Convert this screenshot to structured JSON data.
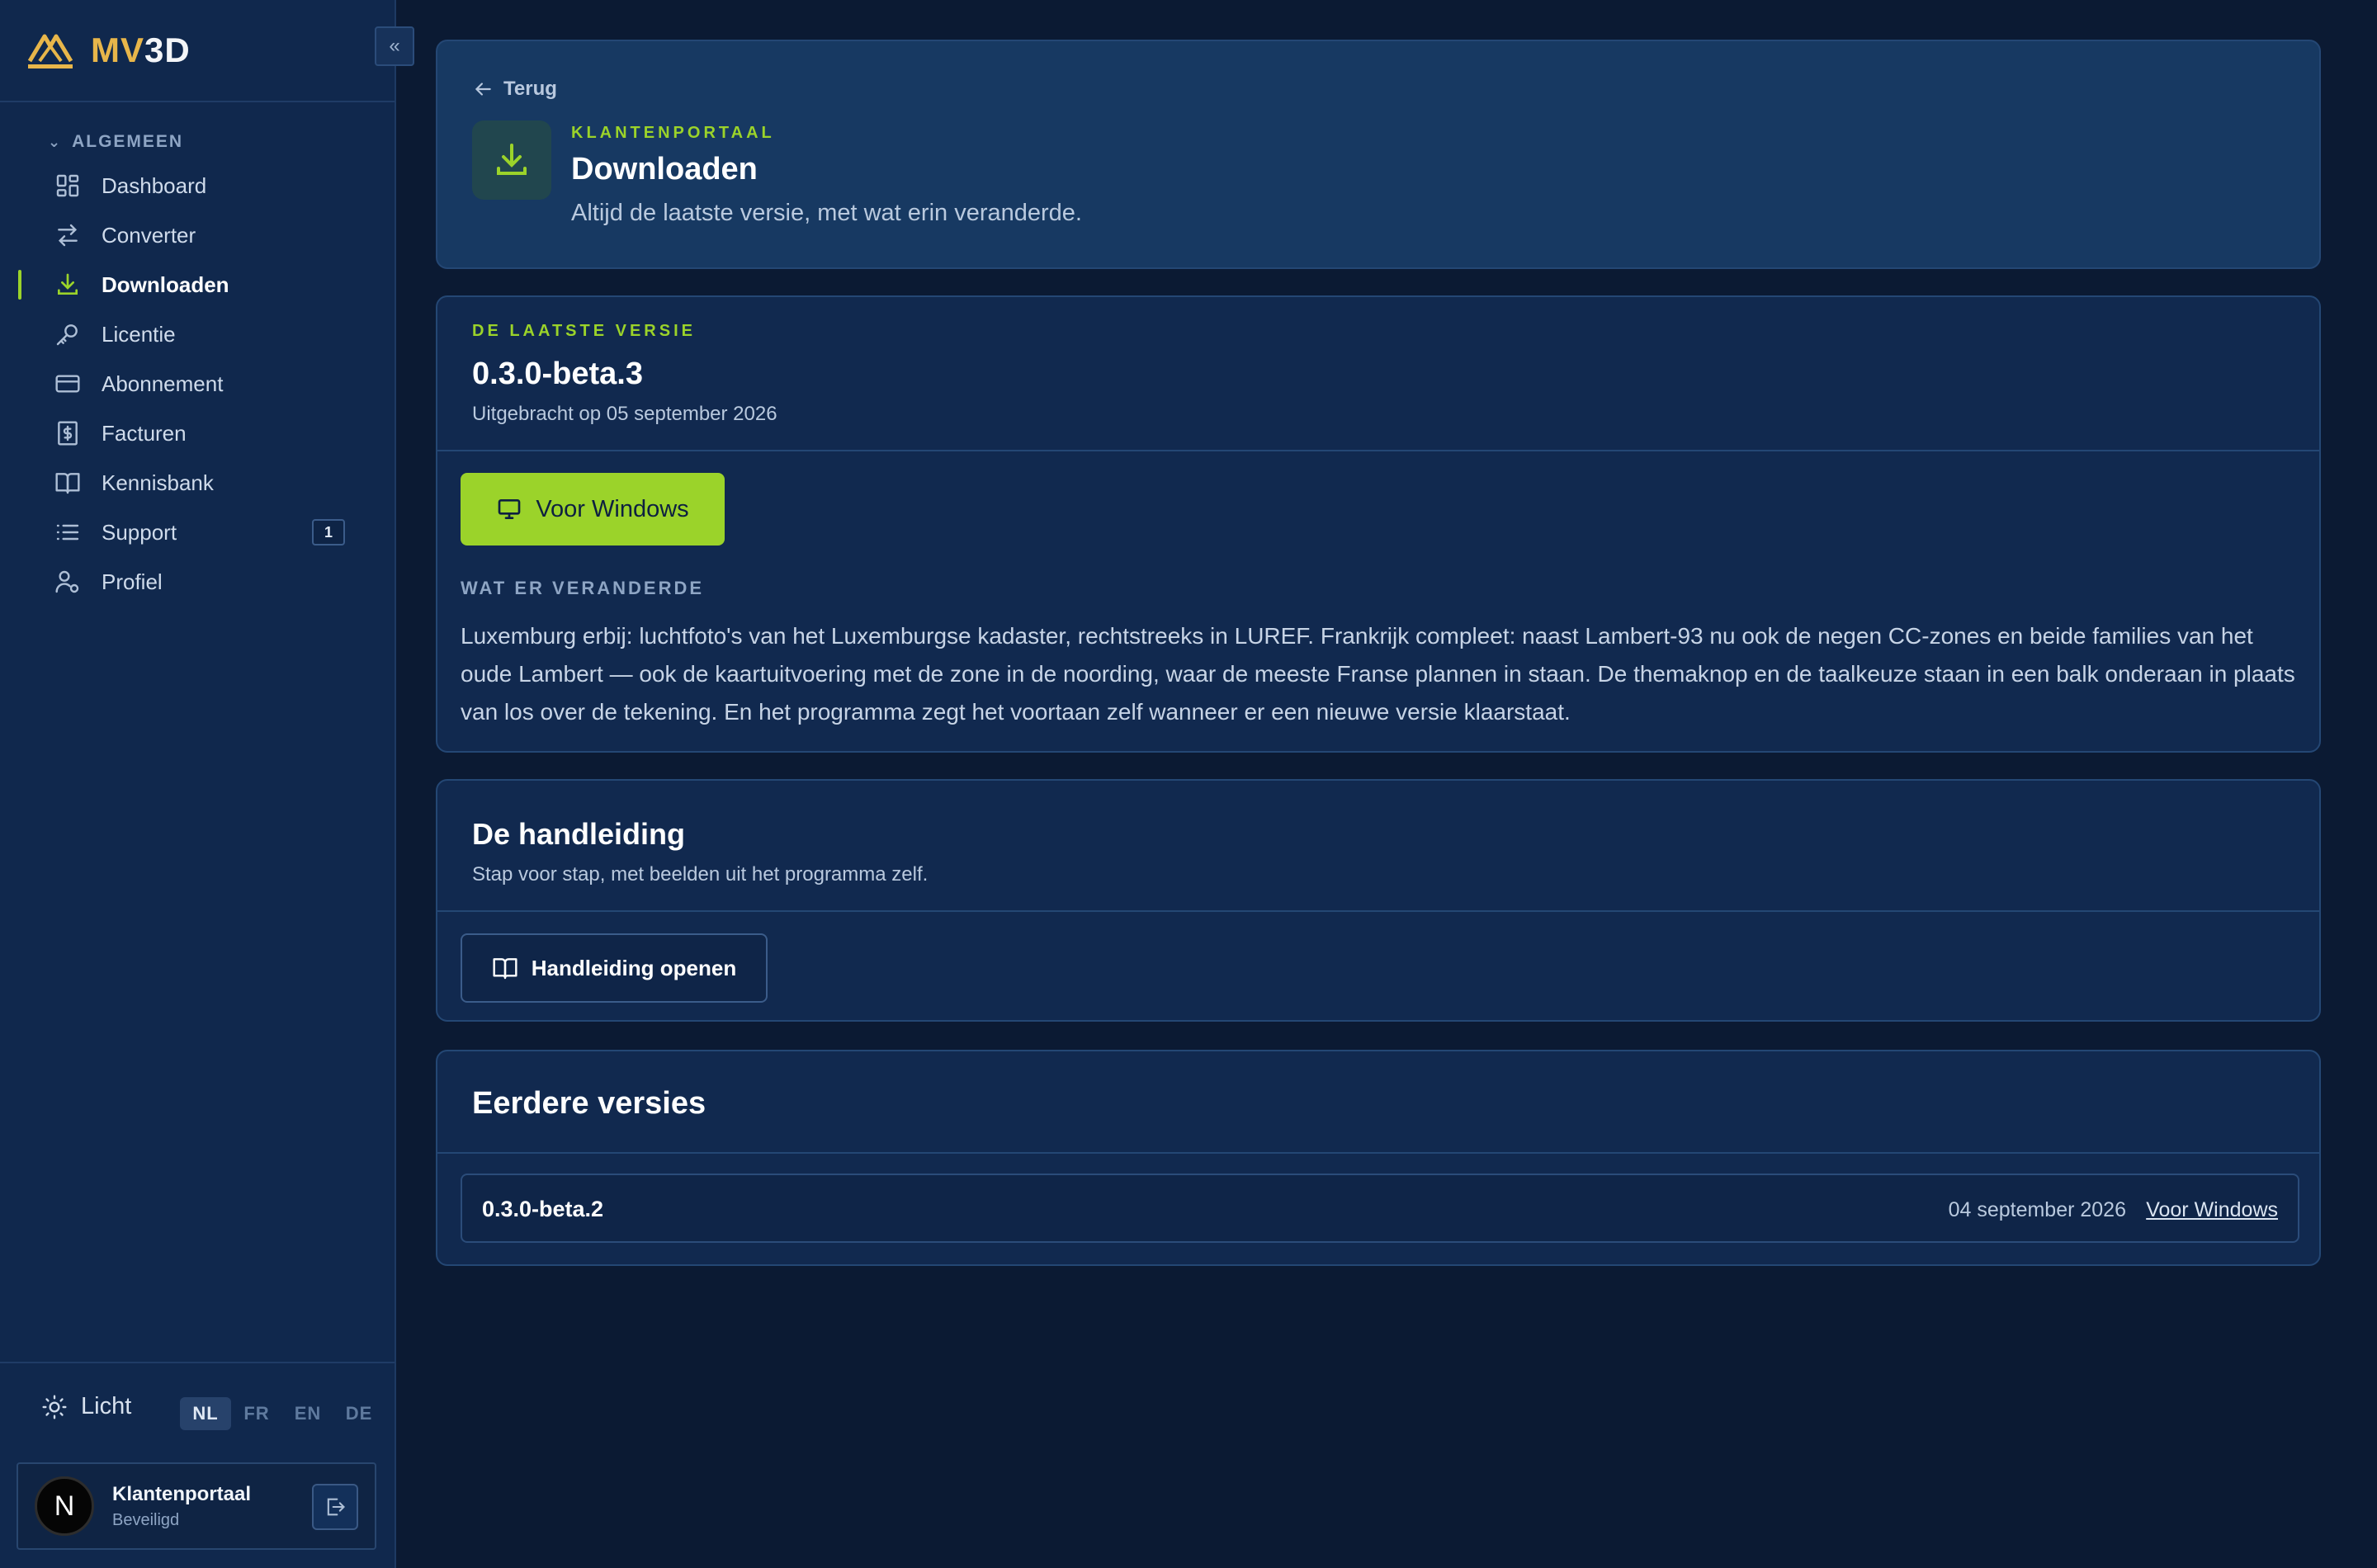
{
  "brand": {
    "prefix": "MV",
    "suffix": "3D"
  },
  "sidebar": {
    "collapse_label": "«",
    "section": "ALGEMEEN",
    "items": [
      {
        "label": "Dashboard",
        "icon": "dashboard-icon"
      },
      {
        "label": "Converter",
        "icon": "arrows-swap-icon"
      },
      {
        "label": "Downloaden",
        "icon": "download-icon",
        "active": true
      },
      {
        "label": "Licentie",
        "icon": "key-icon"
      },
      {
        "label": "Abonnement",
        "icon": "credit-card-icon"
      },
      {
        "label": "Facturen",
        "icon": "invoice-icon"
      },
      {
        "label": "Kennisbank",
        "icon": "book-icon"
      },
      {
        "label": "Support",
        "icon": "list-icon",
        "badge": "1"
      },
      {
        "label": "Profiel",
        "icon": "user-settings-icon"
      }
    ],
    "theme_label": "Licht",
    "languages": [
      "NL",
      "FR",
      "EN",
      "DE"
    ],
    "selected_language": "NL",
    "account": {
      "initial": "N",
      "name": "Klantenportaal",
      "status": "Beveiligd"
    }
  },
  "header": {
    "back_label": "Terug",
    "eyebrow": "KLANTENPORTAAL",
    "title": "Downloaden",
    "subtitle": "Altijd de laatste versie, met wat erin veranderde."
  },
  "latest": {
    "eyebrow": "DE LAATSTE VERSIE",
    "version": "0.3.0-beta.3",
    "released": "Uitgebracht op 05 september 2026",
    "button_label": "Voor Windows",
    "changes_label": "WAT ER VERANDERDE",
    "changes_text": "Luxemburg erbij: luchtfoto's van het Luxemburgse kadaster, rechtstreeks in LUREF. Frankrijk compleet: naast Lambert-93 nu ook de negen CC-zones en beide families van het oude Lambert — ook de kaartuitvoering met de zone in de noording, waar de meeste Franse plannen in staan. De themaknop en de taalkeuze staan in een balk onderaan in plaats van los over de tekening. En het programma zegt het voortaan zelf wanneer er een nieuwe versie klaarstaat."
  },
  "manual": {
    "title": "De handleiding",
    "subtitle": "Stap voor stap, met beelden uit het programma zelf.",
    "button_label": "Handleiding openen"
  },
  "previous": {
    "title": "Eerdere versies",
    "items": [
      {
        "version": "0.3.0-beta.2",
        "date": "04 september 2026",
        "link_label": "Voor Windows"
      }
    ]
  },
  "colors": {
    "accent": "#9bd32a",
    "brand_gold": "#e8b64a",
    "background": "#0b1a33",
    "sidebar": "#10284d"
  }
}
